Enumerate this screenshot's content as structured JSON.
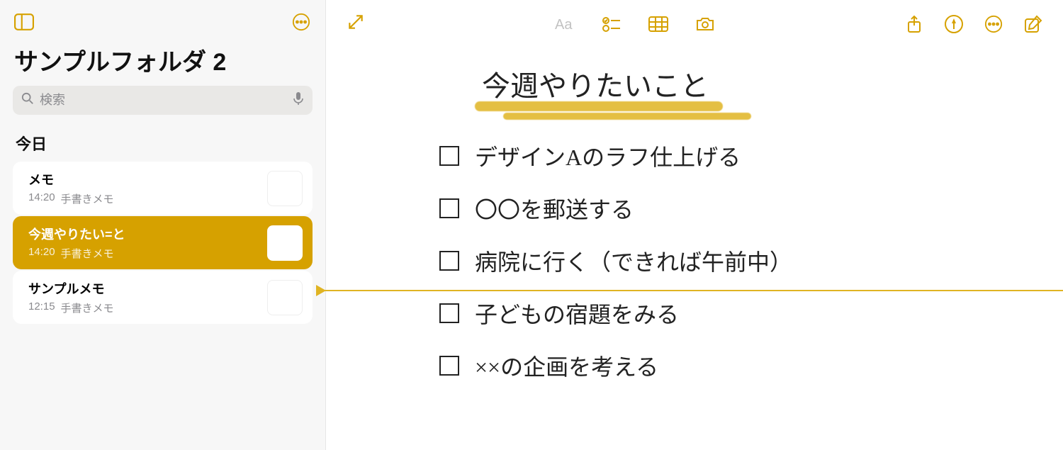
{
  "sidebar": {
    "folder_title": "サンプルフォルダ 2",
    "search_placeholder": "検索",
    "section_today": "今日",
    "notes": [
      {
        "title": "メモ",
        "time": "14:20",
        "subtitle": "手書きメモ",
        "selected": false
      },
      {
        "title": "今週やりたい=と",
        "time": "14:20",
        "subtitle": "手書きメモ",
        "selected": true
      },
      {
        "title": "サンプルメモ",
        "time": "12:15",
        "subtitle": "手書きメモ",
        "selected": false
      }
    ]
  },
  "canvas": {
    "heading": "今週やりたいこと",
    "items": [
      "デザインAのラフ仕上げる",
      "〇〇を郵送する",
      "病院に行く（できれば午前中）",
      "子どもの宿題をみる",
      "××の企画を考える"
    ]
  },
  "icons": {
    "sidebar_toggle": "sidebar-toggle-icon",
    "more": "more-icon",
    "search": "search-icon",
    "mic": "mic-icon",
    "expand": "expand-icon",
    "text_format": "text-format-icon",
    "checklist": "checklist-icon",
    "table": "table-icon",
    "camera": "camera-icon",
    "share": "share-icon",
    "markup": "markup-icon",
    "ellipsis": "ellipsis-icon",
    "compose": "compose-icon"
  },
  "colors": {
    "accent": "#d6a100",
    "sidebar_bg": "#f7f7f7"
  }
}
